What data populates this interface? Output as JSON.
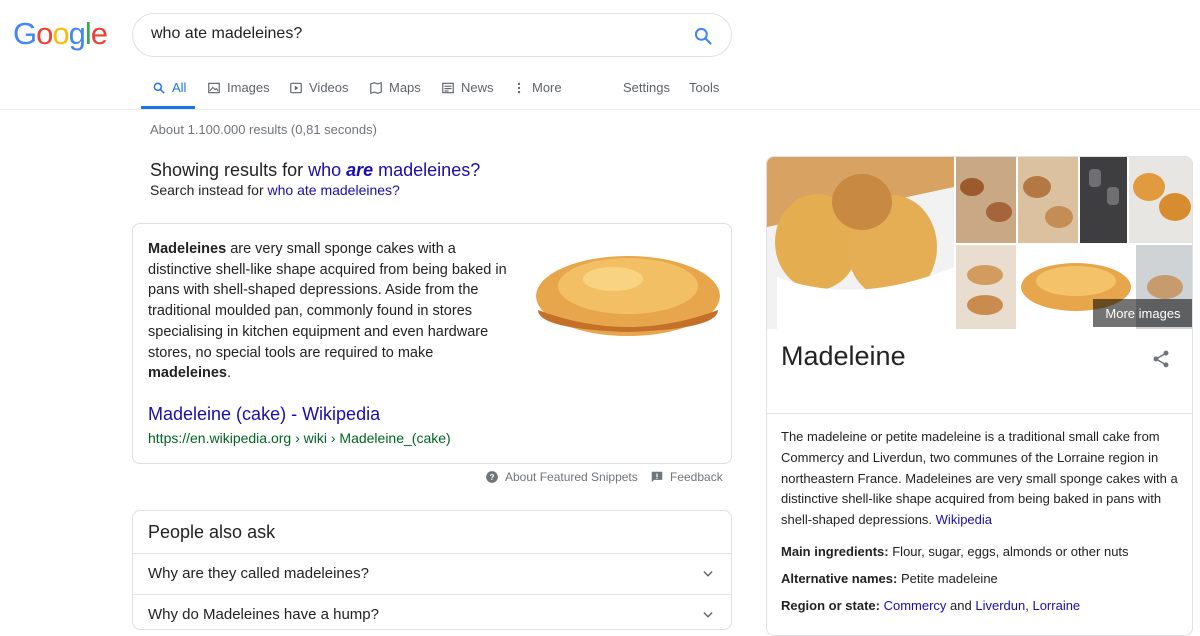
{
  "logo_text": "Google",
  "search": {
    "query": "who ate madeleines?"
  },
  "tabs": [
    {
      "label": "All",
      "icon": "search-icon"
    },
    {
      "label": "Images",
      "icon": "image-icon"
    },
    {
      "label": "Videos",
      "icon": "video-icon"
    },
    {
      "label": "Maps",
      "icon": "map-icon"
    },
    {
      "label": "News",
      "icon": "news-icon"
    },
    {
      "label": "More",
      "icon": "more-vert-icon"
    }
  ],
  "settings_label": "Settings",
  "tools_label": "Tools",
  "result_stats": "About 1.100.000 results (0,81 seconds)",
  "spelling": {
    "showing_prefix": "Showing results for ",
    "corrected_pre": "who ",
    "corrected_em": "are",
    "corrected_post": " madeleines?",
    "instead_prefix": "Search instead for ",
    "instead_query": "who ate madeleines?"
  },
  "snippet": {
    "bold1": "Madeleines",
    "text1": " are very small sponge cakes with a distinctive shell-like shape acquired from being baked in pans with shell-shaped depressions. Aside from the traditional moulded pan, commonly found in stores specialising in kitchen equipment and even hardware stores, no special tools are required to make ",
    "bold2": "madeleines",
    "text2": ".",
    "title": "Madeleine (cake) - Wikipedia",
    "url": "https://en.wikipedia.org › wiki › Madeleine_(cake)"
  },
  "about_snippets": "About Featured Snippets",
  "feedback": "Feedback",
  "paa": {
    "title": "People also ask",
    "questions": [
      "Why are they called madeleines?",
      "Why do Madeleines have a hump?"
    ]
  },
  "knowledge_panel": {
    "more_images": "More images",
    "title": "Madeleine",
    "description": "The madeleine or petite madeleine is a traditional small cake from Commercy and Liverdun, two communes of the Lorraine region in northeastern France. Madeleines are very small sponge cakes with a distinctive shell-like shape acquired from being baked in pans with shell-shaped depressions. ",
    "source": "Wikipedia",
    "facts": {
      "ingredients_label": "Main ingredients:",
      "ingredients_value": " Flour, sugar, eggs, almonds or other nuts",
      "alt_names_label": "Alternative names:",
      "alt_names_value": " Petite madeleine",
      "region_label": "Region or state:",
      "region_link1": "Commercy",
      "region_and": " and ",
      "region_link2": "Liverdun",
      "region_comma": ", ",
      "region_link3": "Lorraine"
    }
  },
  "colors": {
    "link": "#1a0dab",
    "url_green": "#006621",
    "accent_blue": "#1a73e8"
  }
}
